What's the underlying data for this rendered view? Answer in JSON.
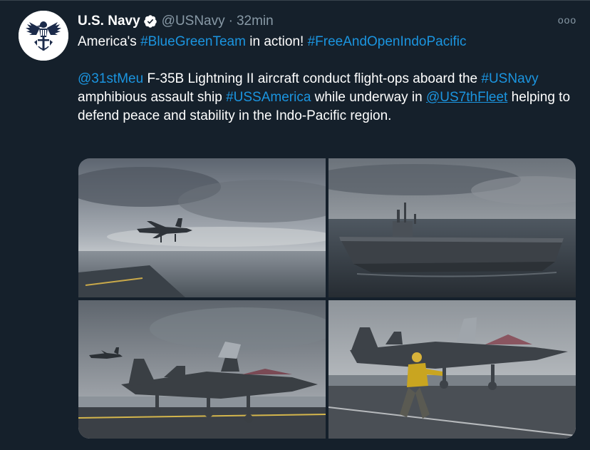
{
  "tweet": {
    "author_name": "U.S. Navy",
    "author_handle": "@USNavy",
    "separator": "·",
    "time": "32min",
    "more_label": "ooo",
    "line1": {
      "t1": "America's ",
      "tag1": "#BlueGreenTeam",
      "t2": " in action! ",
      "tag2": "#FreeAndOpenIndoPacific"
    },
    "body": {
      "mention1": "@31stMeu",
      "t1": " F-35B Lightning II aircraft conduct flight-ops aboard the ",
      "tag1": "#USNavy",
      "t2": " amphibious assault ship ",
      "tag2": "#USSAmerica",
      "t3": " while underway in ",
      "mention2": "@US7thFleet",
      "t4": " helping to defend peace and stability in the Indo-Pacific region."
    }
  },
  "colors": {
    "background": "#15202b",
    "link": "#1b95e0",
    "secondary_text": "#8899a6",
    "verified_badge": "#ffffff"
  },
  "icons": {
    "verified": "verified-badge-icon",
    "more": "more-options-icon",
    "avatar": "us-navy-eagle-emblem"
  },
  "media": {
    "photo_count": 4
  }
}
